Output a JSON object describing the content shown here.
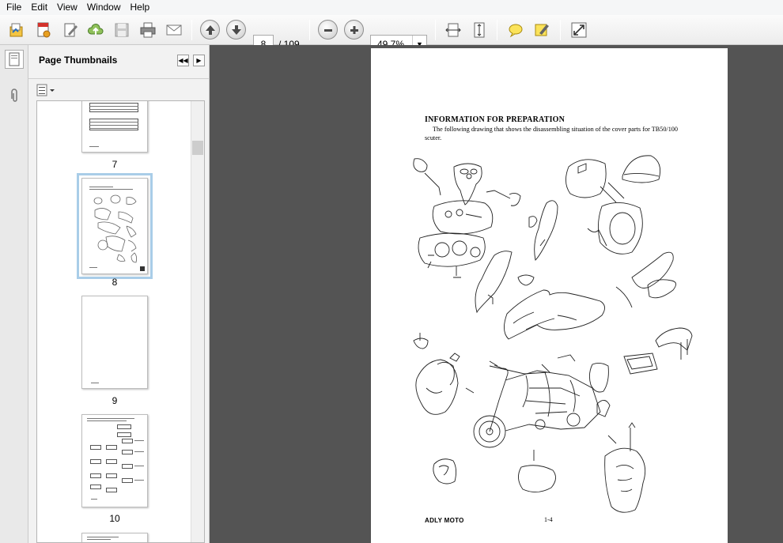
{
  "menu": [
    "File",
    "Edit",
    "View",
    "Window",
    "Help"
  ],
  "toolbar": {
    "current_page": "8",
    "total_pages": "/ 109",
    "zoom": "49.7%"
  },
  "panel": {
    "title": "Page Thumbnails"
  },
  "thumbnails": [
    {
      "label": "7"
    },
    {
      "label": "8"
    },
    {
      "label": "9"
    },
    {
      "label": "10"
    }
  ],
  "document": {
    "heading": "INFORMATION FOR PREPARATION",
    "body": "The following drawing that shows the disassembling situation of the cover parts for TB50/100 scuter.",
    "footer_brand": "ADLY MOTO",
    "footer_page": "1-4"
  },
  "colors": {
    "document_bg": "#545454",
    "selection_outline": "#a9cde8"
  }
}
